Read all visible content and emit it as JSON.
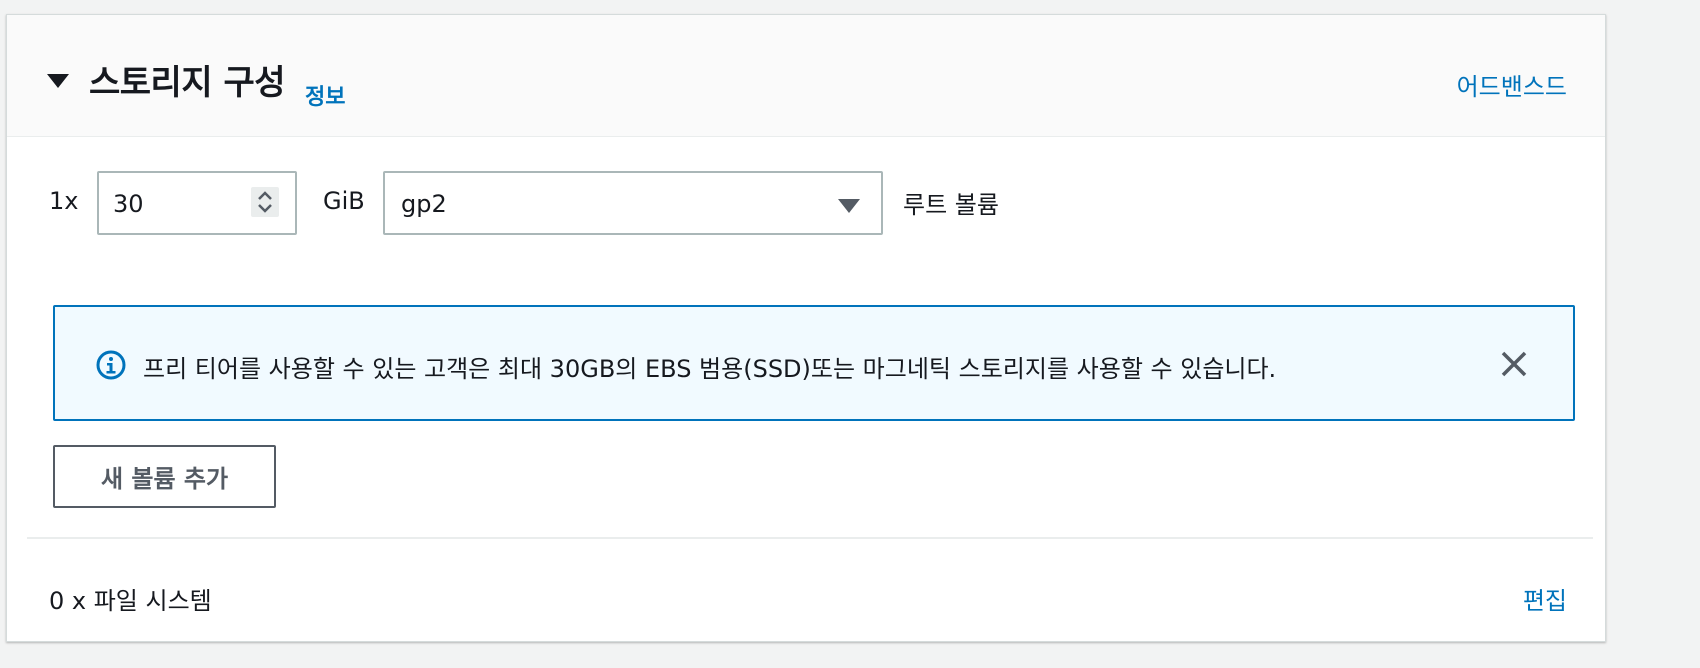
{
  "header": {
    "title": "스토리지 구성",
    "info_link": "정보",
    "advanced_link": "어드밴스드"
  },
  "volume": {
    "multiplier": "1x",
    "size_value": "30",
    "size_unit": "GiB",
    "type_selected": "gp2",
    "role_label": "루트 볼륨"
  },
  "alert": {
    "message": "프리 티어를 사용할 수 있는 고객은 최대 30GB의 EBS 범용(SSD)또는 마그네틱 스토리지를 사용할 수 있습니다."
  },
  "actions": {
    "add_volume_label": "새 볼륨 추가"
  },
  "file_systems": {
    "summary": "0 x 파일 시스템",
    "edit_label": "편집"
  },
  "icons": {
    "collapse": "caret-down-icon",
    "stepper": "stepper-icon",
    "select_caret": "caret-down-icon",
    "info": "info-circle-icon",
    "dismiss": "close-icon"
  },
  "colors": {
    "accent": "#0073bb",
    "alert_background": "#f1faff",
    "text": "#16191f",
    "border": "#aab7b8"
  }
}
